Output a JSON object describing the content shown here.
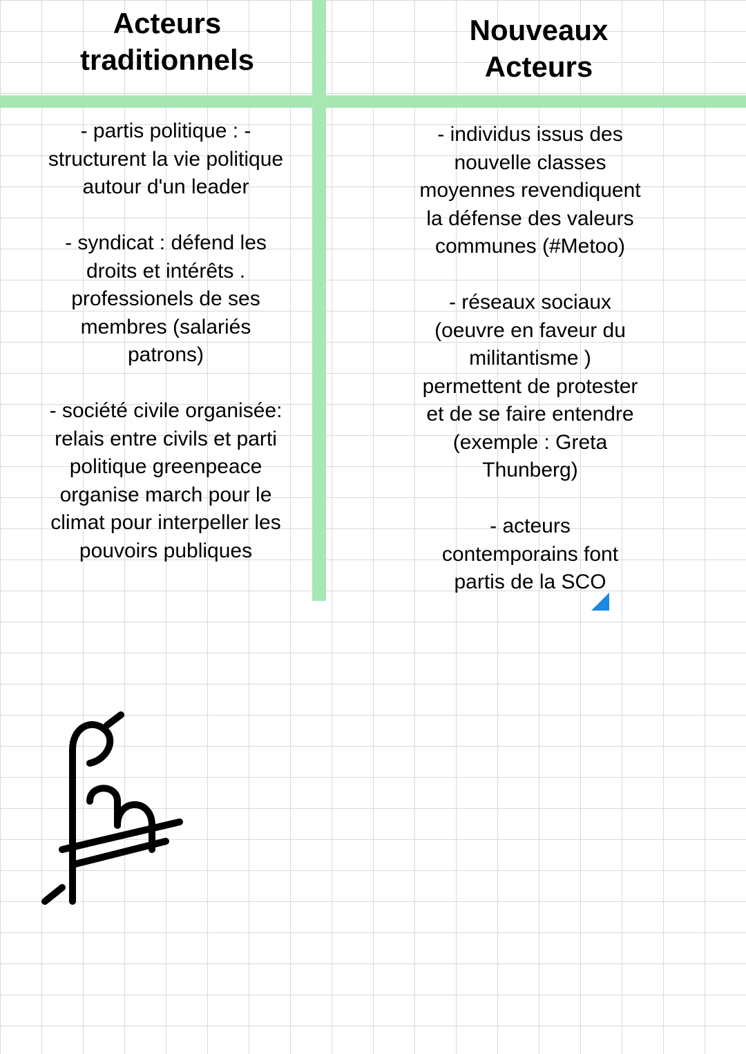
{
  "columns": {
    "left": {
      "title": "Acteurs\ntraditionnels",
      "body": "- partis politique : -\nstructurent la vie politique\nautour d'un leader\n\n- syndicat :  défend les\ndroits et intérêts .\nprofessionels de ses\nmembres (salariés\npatrons)\n\n- société civile organisée:\nrelais entre civils et parti\npolitique greenpeace\norganise march pour le\nclimat pour interpeller les\npouvoirs publiques"
    },
    "right": {
      "title": "Nouveaux\nActeurs",
      "body": "- individus issus des\nnouvelle classes\nmoyennes revendiquent\nla défense des valeurs\ncommunes (#Metoo)\n\n- réseaux sociaux\n(oeuvre en faveur du\nmilitantisme )\npermettent de protester\net de se faire entendre\n(exemple :  Greta\nThunberg)\n\n- acteurs\ncontemporains font\npartis de la SCO"
    }
  },
  "footer_word": "fin",
  "accent_color": "#a6e7b4",
  "triangle_color": "#1e88e5"
}
